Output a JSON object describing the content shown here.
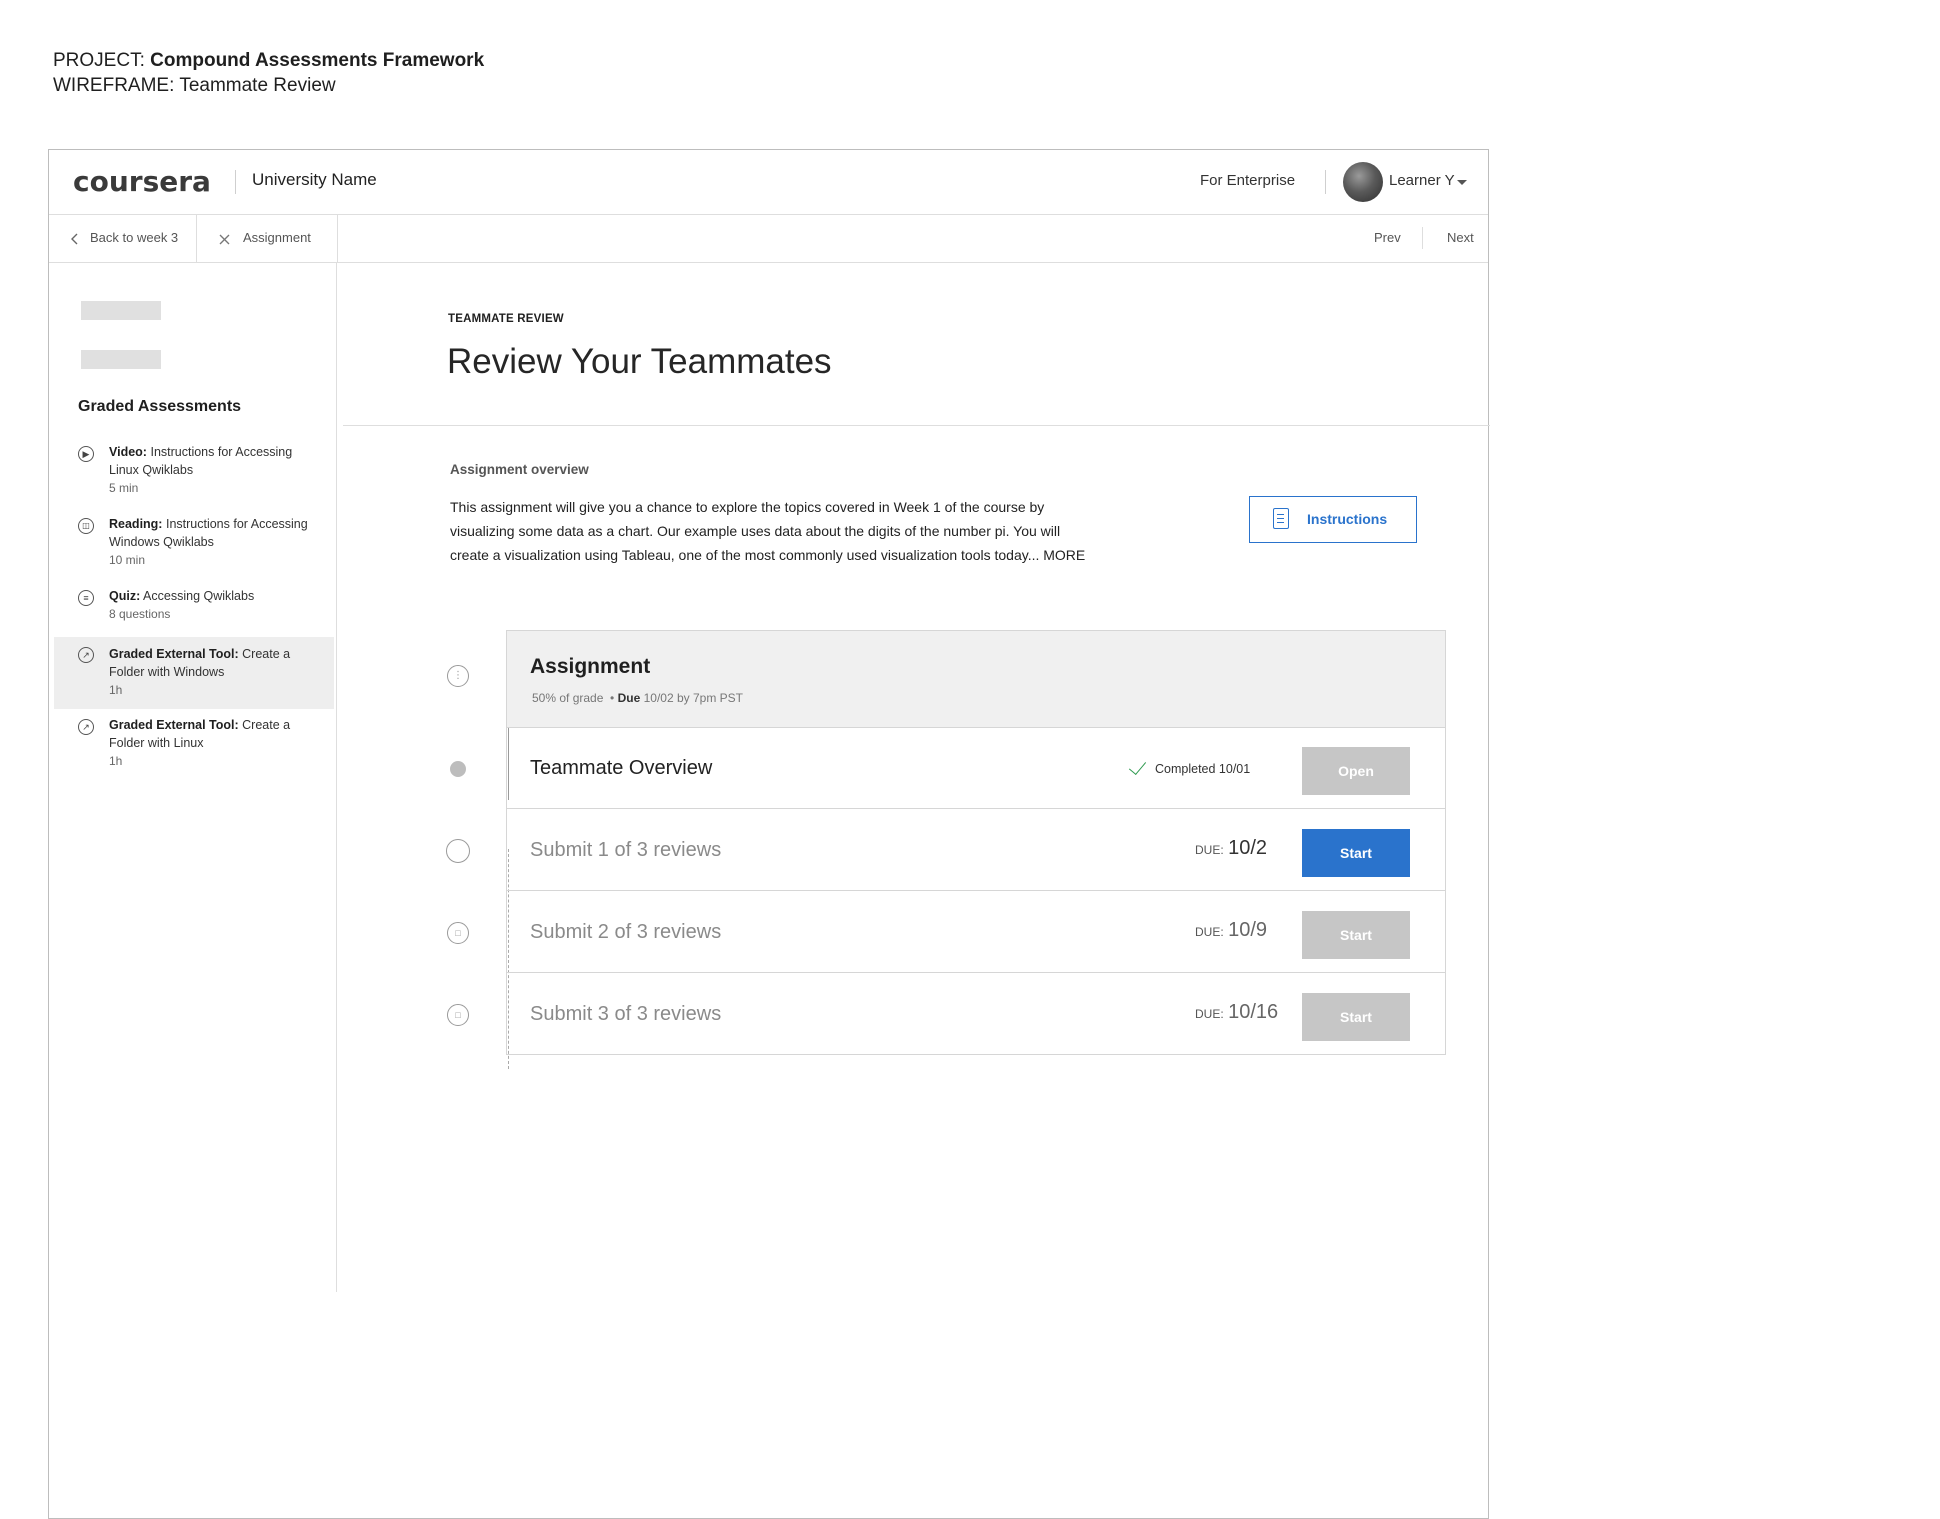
{
  "project": {
    "project_label": "PROJECT:",
    "project_name": "Compound Assessments Framework",
    "wireframe_label": "WIREFRAME:",
    "wireframe_name": "Teammate Review"
  },
  "header": {
    "logo": "coursera",
    "university": "University Name",
    "enterprise": "For Enterprise",
    "user": "Learner Y"
  },
  "subnav": {
    "back": "Back to week 3",
    "assignment": "Assignment",
    "prev": "Prev",
    "next": "Next"
  },
  "sidebar": {
    "heading": "Graded Assessments",
    "items": [
      {
        "type": "Video:",
        "title": "Instructions for Accessing Linux Qwiklabs",
        "meta": "5 min",
        "icon": "play-icon",
        "active": false
      },
      {
        "type": "Reading:",
        "title": "Instructions for Accessing Windows Qwiklabs",
        "meta": "10 min",
        "icon": "book-icon",
        "active": false
      },
      {
        "type": "Quiz:",
        "title": "Accessing Qwiklabs",
        "meta": "8 questions",
        "icon": "quiz-icon",
        "active": false
      },
      {
        "type": "Graded External Tool:",
        "title": "Create a Folder with Windows",
        "meta": "1h",
        "icon": "external-link-icon",
        "active": true
      },
      {
        "type": "Graded External Tool:",
        "title": "Create a Folder with Linux",
        "meta": "1h",
        "icon": "external-link-icon",
        "active": false
      }
    ]
  },
  "main": {
    "eyebrow": "TEAMMATE REVIEW",
    "title": "Review Your Teammates",
    "overview_label": "Assignment overview",
    "overview_text": "This assignment will give you a chance to explore the topics covered in Week 1 of the course by visualizing some data as a chart. Our example uses data about the digits of the number pi. You will create a visualization using Tableau, one of the most commonly used visualization tools today... MORE",
    "instructions_label": "Instructions"
  },
  "assignment": {
    "title": "Assignment",
    "grade": "50% of grade",
    "due_label": "Due",
    "due_value": "10/02 by 7pm PST",
    "rows": [
      {
        "title": "Teammate Overview",
        "status": "Completed 10/01",
        "button": "Open"
      },
      {
        "title": "Submit 1 of 3 reviews",
        "due_label": "DUE:",
        "due": "10/2",
        "button": "Start"
      },
      {
        "title": "Submit 2 of 3 reviews",
        "due_label": "DUE:",
        "due": "10/9",
        "button": "Start"
      },
      {
        "title": "Submit 3 of 3 reviews",
        "due_label": "DUE:",
        "due": "10/16",
        "button": "Start"
      }
    ]
  },
  "colors": {
    "accent": "#2a73cc",
    "disabled": "#c6c6c6",
    "check": "#2e9a4f"
  }
}
